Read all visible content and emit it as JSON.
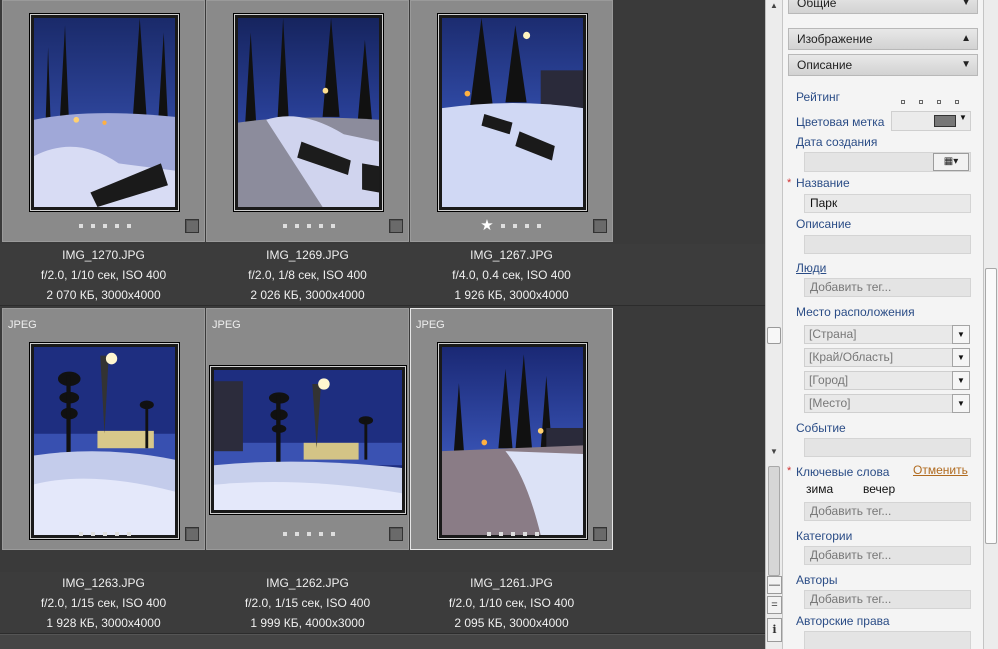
{
  "gallery": {
    "rows": [
      [
        {
          "name": "IMG_1270.JPG",
          "exposure": "f/2.0, 1/10 сек, ISO 400",
          "size": "2 070 КБ, 3000x4000",
          "format": "",
          "stars": 0
        },
        {
          "name": "IMG_1269.JPG",
          "exposure": "f/2.0, 1/8 сек, ISO 400",
          "size": "2 026 КБ, 3000x4000",
          "format": "",
          "stars": 0
        },
        {
          "name": "IMG_1267.JPG",
          "exposure": "f/4.0, 0.4 сек, ISO 400",
          "size": "1 926 КБ, 3000x4000",
          "format": "",
          "stars": 1
        }
      ],
      [
        {
          "name": "IMG_1263.JPG",
          "exposure": "f/2.0, 1/15 сек, ISO 400",
          "size": "1 928 КБ, 3000x4000",
          "format": "JPEG",
          "stars": 0
        },
        {
          "name": "IMG_1262.JPG",
          "exposure": "f/2.0, 1/15 сек, ISO 400",
          "size": "1 999 КБ, 4000x3000",
          "format": "JPEG",
          "stars": 0
        },
        {
          "name": "IMG_1261.JPG",
          "exposure": "f/2.0, 1/10 сек, ISO 400",
          "size": "2 095 КБ, 3000x4000",
          "format": "JPEG",
          "stars": 0
        }
      ]
    ],
    "rating_star": "★"
  },
  "panel": {
    "sections": {
      "general": "Общие",
      "image": "Изображение",
      "description": "Описание"
    },
    "labels": {
      "rating": "Рейтинг",
      "color_label": "Цветовая метка",
      "date_created": "Дата создания",
      "title": "Название",
      "description": "Описание",
      "people": "Люди",
      "location": "Место расположения",
      "event": "Событие",
      "keywords": "Ключевые слова",
      "categories": "Категории",
      "authors": "Авторы",
      "copyright": "Авторские права"
    },
    "required_mark": "*",
    "title_value": "Парк",
    "add_tag_placeholder": "Добавить тег...",
    "location": {
      "country": "[Страна]",
      "region": "[Край/Область]",
      "city": "[Город]",
      "place": "[Место]"
    },
    "keywords_cancel": "Отменить",
    "keywords": [
      "зима",
      "вечер"
    ],
    "calendar_icon": "▦▾",
    "dropdown_arrow": "▼"
  },
  "scrollbar": {
    "info_label": "i",
    "eq_label": "=",
    "dash_label": "—"
  }
}
